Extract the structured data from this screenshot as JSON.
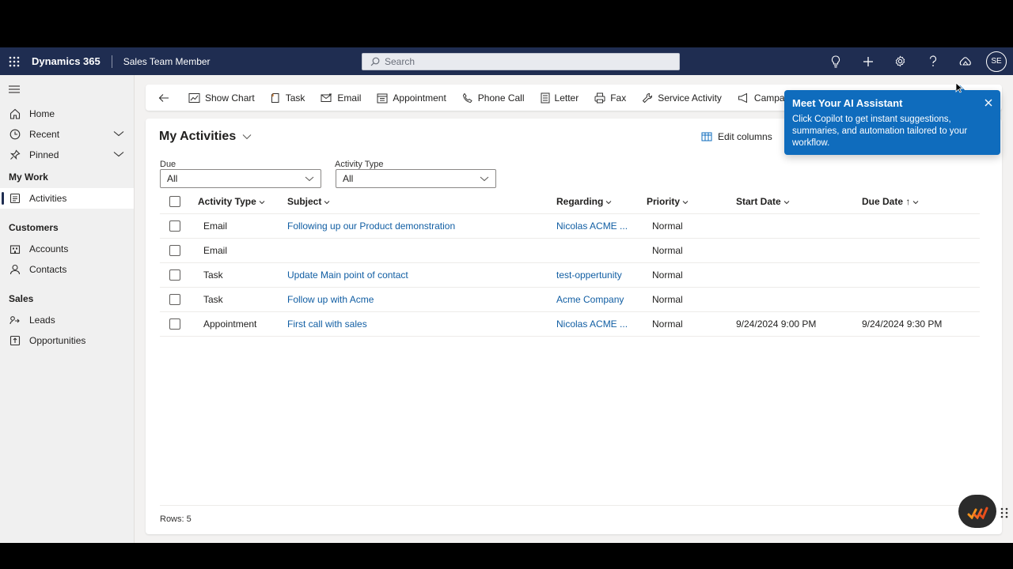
{
  "topbar": {
    "app_name": "Dynamics 365",
    "area_name": "Sales Team Member",
    "search_placeholder": "Search",
    "avatar_initials": "SE",
    "colors": {
      "bar": "#1f2d51",
      "accent": "#0f6cbd"
    }
  },
  "sidebar": {
    "items_top": [
      {
        "label": "Home",
        "icon": "home-icon"
      },
      {
        "label": "Recent",
        "icon": "clock-icon"
      },
      {
        "label": "Pinned",
        "icon": "pin-icon"
      }
    ],
    "my_work_heading": "My Work",
    "activities_label": "Activities",
    "customers_heading": "Customers",
    "accounts_label": "Accounts",
    "contacts_label": "Contacts",
    "sales_heading": "Sales",
    "leads_label": "Leads",
    "opportunities_label": "Opportunities"
  },
  "commands": [
    {
      "label": "Show Chart",
      "icon": "chart-icon"
    },
    {
      "label": "Task",
      "icon": "task-icon"
    },
    {
      "label": "Email",
      "icon": "email-icon"
    },
    {
      "label": "Appointment",
      "icon": "calendar-icon"
    },
    {
      "label": "Phone Call",
      "icon": "phone-icon"
    },
    {
      "label": "Letter",
      "icon": "letter-icon"
    },
    {
      "label": "Fax",
      "icon": "fax-icon"
    },
    {
      "label": "Service Activity",
      "icon": "service-icon"
    },
    {
      "label": "Campaig",
      "icon": "megaphone-icon"
    }
  ],
  "view": {
    "title": "My Activities",
    "edit_columns": "Edit columns",
    "filters": {
      "due_label": "Due",
      "due_value": "All",
      "type_label": "Activity Type",
      "type_value": "All"
    },
    "columns": [
      "Activity Type",
      "Subject",
      "Regarding",
      "Priority",
      "Start Date",
      "Due Date"
    ],
    "due_sort_arrow": "↑",
    "rows": [
      {
        "type": "Email",
        "subject": "Following up our Product demonstration",
        "regarding": "Nicolas ACME ...",
        "priority": "Normal",
        "start": "",
        "due": ""
      },
      {
        "type": "Email",
        "subject": "",
        "regarding": "",
        "priority": "Normal",
        "start": "",
        "due": ""
      },
      {
        "type": "Task",
        "subject": "Update Main point of contact",
        "regarding": "test-oppertunity",
        "priority": "Normal",
        "start": "",
        "due": ""
      },
      {
        "type": "Task",
        "subject": "Follow up with Acme",
        "regarding": "Acme Company",
        "priority": "Normal",
        "start": "",
        "due": ""
      },
      {
        "type": "Appointment",
        "subject": "First call with sales",
        "regarding": "Nicolas ACME ...",
        "priority": "Normal",
        "start": "9/24/2024 9:00 PM",
        "due": "9/24/2024 9:30 PM"
      }
    ],
    "row_count": "Rows: 5"
  },
  "callout": {
    "title": "Meet Your AI Assistant",
    "body": "Click Copilot to get instant suggestions, summaries, and automation tailored to your workflow."
  }
}
